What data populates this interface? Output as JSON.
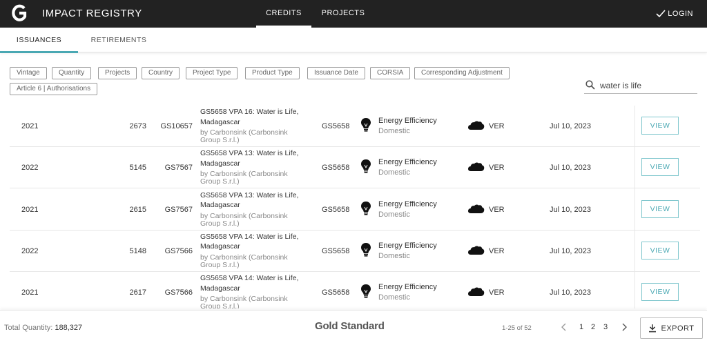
{
  "header": {
    "title": "IMPACT REGISTRY",
    "nav": [
      {
        "label": "CREDITS",
        "active": true
      },
      {
        "label": "PROJECTS",
        "active": false
      }
    ],
    "login_label": "LOGIN"
  },
  "subtabs": [
    {
      "label": "ISSUANCES",
      "active": true
    },
    {
      "label": "RETIREMENTS",
      "active": false
    }
  ],
  "filters": {
    "chips": [
      "Vintage",
      "Quantity",
      "Projects",
      "Country",
      "Project Type",
      "Product Type",
      "Issuance Date",
      "CORSIA",
      "Corresponding Adjustment",
      "Article 6 | Authorisations"
    ],
    "search": {
      "value": "water is life",
      "placeholder": ""
    }
  },
  "rows": [
    {
      "vintage": "2021",
      "quantity": "2673",
      "gsid": "GS10657",
      "name": "GS5658 VPA 16: Water is Life, Madagascar",
      "by": "by Carbonsink (Carbonsink Group S.r.l.)",
      "project": "GS5658",
      "type": "Energy Efficiency",
      "subtype": "Domestic",
      "cert": "VER",
      "date": "Jul 10, 2023",
      "action": "VIEW"
    },
    {
      "vintage": "2022",
      "quantity": "5145",
      "gsid": "GS7567",
      "name": "GS5658 VPA 13: Water is Life, Madagascar",
      "by": "by Carbonsink (Carbonsink Group S.r.l.)",
      "project": "GS5658",
      "type": "Energy Efficiency",
      "subtype": "Domestic",
      "cert": "VER",
      "date": "Jul 10, 2023",
      "action": "VIEW"
    },
    {
      "vintage": "2021",
      "quantity": "2615",
      "gsid": "GS7567",
      "name": "GS5658 VPA 13: Water is Life, Madagascar",
      "by": "by Carbonsink (Carbonsink Group S.r.l.)",
      "project": "GS5658",
      "type": "Energy Efficiency",
      "subtype": "Domestic",
      "cert": "VER",
      "date": "Jul 10, 2023",
      "action": "VIEW"
    },
    {
      "vintage": "2022",
      "quantity": "5148",
      "gsid": "GS7566",
      "name": "GS5658 VPA 14: Water is Life, Madagascar",
      "by": "by Carbonsink (Carbonsink Group S.r.l.)",
      "project": "GS5658",
      "type": "Energy Efficiency",
      "subtype": "Domestic",
      "cert": "VER",
      "date": "Jul 10, 2023",
      "action": "VIEW"
    },
    {
      "vintage": "2021",
      "quantity": "2617",
      "gsid": "GS7566",
      "name": "GS5658 VPA 14: Water is Life, Madagascar",
      "by": "by Carbonsink (Carbonsink Group S.r.l.)",
      "project": "GS5658",
      "type": "Energy Efficiency",
      "subtype": "Domestic",
      "cert": "VER",
      "date": "Jul 10, 2023",
      "action": "VIEW"
    }
  ],
  "footer": {
    "total_label": "Total Quantity:",
    "total_value": "188,327",
    "brand": "Gold Standard",
    "range": "1-25 of 52",
    "pages": [
      "1",
      "2",
      "3"
    ],
    "current_page": "1",
    "export_label": "EXPORT"
  },
  "icons": {
    "logo": "gold-standard-g-logo",
    "login": "checkmark-icon",
    "search": "search-icon",
    "type": "lightbulb-icon",
    "cert": "cloud-icon",
    "prev": "chevron-left-icon",
    "next": "chevron-right-icon",
    "export": "download-icon"
  },
  "colors": {
    "topbar": "#222222",
    "accent": "#4aa8b3"
  }
}
